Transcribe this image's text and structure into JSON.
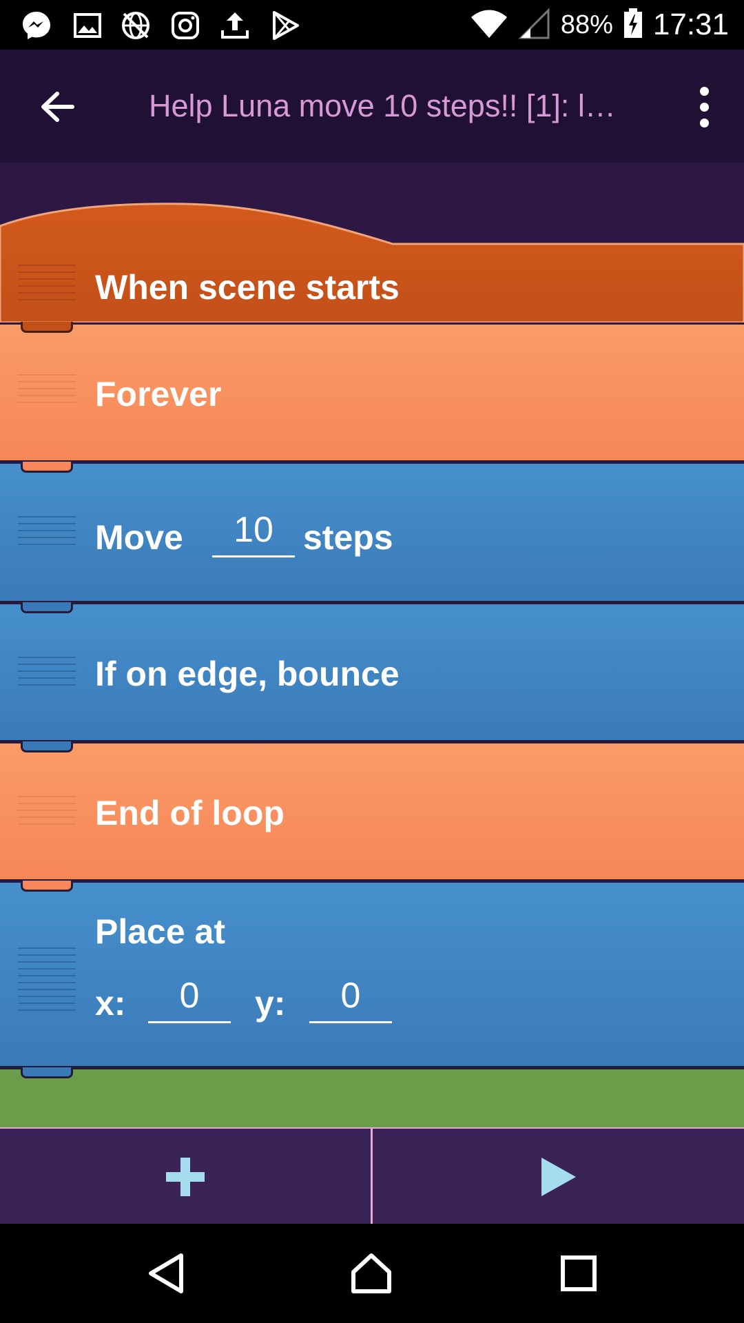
{
  "status_bar": {
    "battery": "88%",
    "time": "17:31",
    "icons": [
      "messenger-icon",
      "gallery-icon",
      "no-network-globe-icon",
      "instagram-icon",
      "upload-icon",
      "play-store-icon",
      "wifi-icon",
      "signal-icon",
      "battery-charging-icon"
    ]
  },
  "app_bar": {
    "title": "Help Luna move 10 steps!! [1]: l…",
    "back_icon": "arrow-left-icon",
    "menu_icon": "more-vert-icon"
  },
  "bricks": {
    "when_scene_starts": {
      "label": "When scene starts",
      "color": "#c9541a"
    },
    "forever": {
      "label": "Forever",
      "color": "#f99c68"
    },
    "move": {
      "label": "Move",
      "value": "10",
      "suffix": "steps",
      "color": "#4690cd"
    },
    "bounce": {
      "label": "If on edge, bounce",
      "color": "#4690cd"
    },
    "end_loop": {
      "label": "End of loop",
      "color": "#f99c68"
    },
    "place_at": {
      "label": "Place at",
      "x_label": "x:",
      "x_value": "0",
      "y_label": "y:",
      "y_value": "0",
      "color": "#4690cd"
    },
    "next_brick": {
      "color": "#6b9c49"
    }
  },
  "bottom_bar": {
    "add_icon": "plus-icon",
    "play_icon": "play-icon",
    "accent": "#a6dcf0"
  },
  "nav_bar": {
    "back_icon": "nav-back-icon",
    "home_icon": "nav-home-icon",
    "recents_icon": "nav-recents-icon"
  }
}
